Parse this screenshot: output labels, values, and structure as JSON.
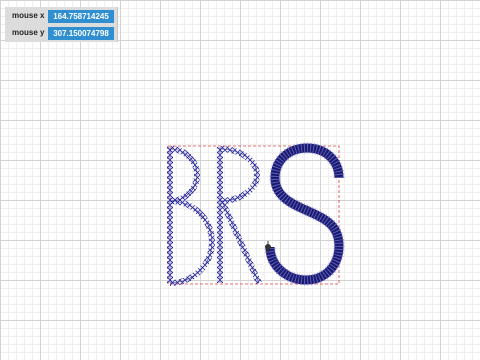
{
  "readout": {
    "mouse_x": {
      "label": "mouse x",
      "value": "164.758714245"
    },
    "mouse_y": {
      "label": "mouse y",
      "value": "307.150074798"
    }
  },
  "colors": {
    "grid_major": "#d2d2d2",
    "grid_minor": "#efefef",
    "letter_stroke": "#1a1a8c",
    "bounds_outline": "#e04040",
    "value_box": "#2f8fd0"
  },
  "glyphs": [
    "B",
    "R",
    "S"
  ]
}
